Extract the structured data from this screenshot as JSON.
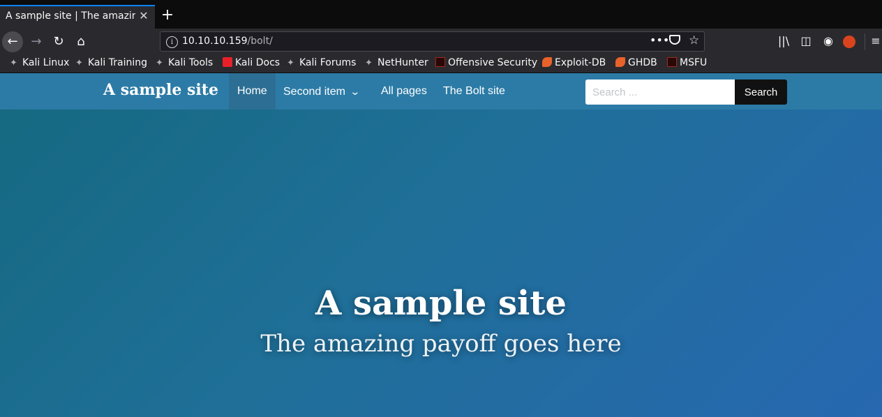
{
  "browser": {
    "tab_title": "A sample site | The amazing payoff goes here",
    "tab_close": "✕",
    "new_tab": "+",
    "url_host": "10.10.10.159",
    "url_path": "/bolt/",
    "bookmarks": [
      {
        "label": "Kali Linux",
        "icon": "kali-dragon-icon"
      },
      {
        "label": "Kali Training",
        "icon": "kali-dragon-icon"
      },
      {
        "label": "Kali Tools",
        "icon": "kali-dragon-icon"
      },
      {
        "label": "Kali Docs",
        "icon": "kali-docs-icon"
      },
      {
        "label": "Kali Forums",
        "icon": "kali-dragon-icon"
      },
      {
        "label": "NetHunter",
        "icon": "kali-dragon-icon"
      },
      {
        "label": "Offensive Security",
        "icon": "offsec-icon"
      },
      {
        "label": "Exploit-DB",
        "icon": "exploitdb-icon"
      },
      {
        "label": "GHDB",
        "icon": "exploitdb-icon"
      },
      {
        "label": "MSFU",
        "icon": "offsec-icon"
      }
    ]
  },
  "site": {
    "brand": "A sample site",
    "nav": [
      {
        "label": "Home",
        "active": true
      },
      {
        "label": "Second item",
        "dropdown": true
      },
      {
        "label": "All pages"
      },
      {
        "label": "The Bolt site"
      }
    ],
    "search_placeholder": "Search ...",
    "search_button": "Search",
    "hero_title": "A sample site",
    "hero_subtitle": "The amazing payoff goes here"
  },
  "colors": {
    "site_nav": "#2c7ba6",
    "hero_gradient_start": "#15697f",
    "hero_gradient_end": "#2768b0",
    "tab_accent": "#0a84ff"
  }
}
